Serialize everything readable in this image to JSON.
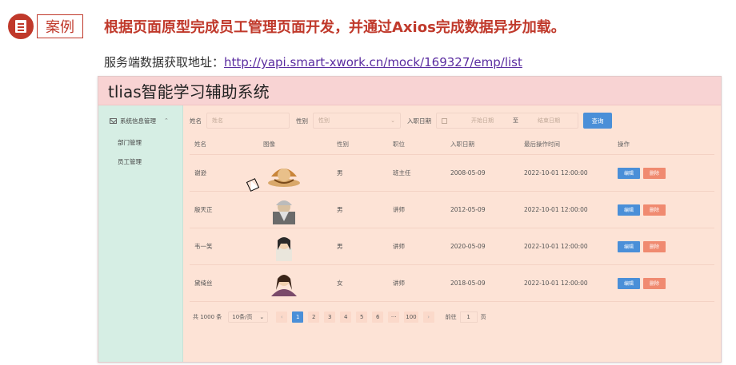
{
  "slide": {
    "case_label": "案例",
    "title": "根据页面原型完成员工管理页面开发，并通过Axios完成数据异步加载。",
    "source_prefix": "服务端数据获取地址：",
    "source_url": "http://yapi.smart-xwork.cn/mock/169327/emp/list"
  },
  "app": {
    "title": "tlias智能学习辅助系统",
    "sidebar": {
      "group_label": "系统信息管理",
      "group_icon": "mail-icon",
      "items": [
        {
          "label": "部门管理"
        },
        {
          "label": "员工管理"
        }
      ]
    },
    "search": {
      "name_label": "姓名",
      "name_placeholder": "姓名",
      "gender_label": "性别",
      "gender_placeholder": "性别",
      "date_label": "入职日期",
      "date_start_placeholder": "开始日期",
      "date_separator": "至",
      "date_end_placeholder": "结束日期",
      "query_button": "查询"
    },
    "table": {
      "headers": [
        "姓名",
        "图像",
        "性别",
        "职位",
        "入职日期",
        "最后操作时间",
        "操作"
      ],
      "edit_label": "编辑",
      "delete_label": "删除",
      "rows": [
        {
          "name": "谢逊",
          "gender": "男",
          "job": "班主任",
          "entry_date": "2008-05-09",
          "update_time": "2022-10-01 12:00:00"
        },
        {
          "name": "殷天正",
          "gender": "男",
          "job": "讲师",
          "entry_date": "2012-05-09",
          "update_time": "2022-10-01 12:00:00"
        },
        {
          "name": "韦一笑",
          "gender": "男",
          "job": "讲师",
          "entry_date": "2020-05-09",
          "update_time": "2022-10-01 12:00:00"
        },
        {
          "name": "黛绮丝",
          "gender": "女",
          "job": "讲师",
          "entry_date": "2018-05-09",
          "update_time": "2022-10-01 12:00:00"
        }
      ]
    },
    "pagination": {
      "total": "共 1000 条",
      "page_size": "10条/页",
      "pages": [
        "1",
        "2",
        "3",
        "4",
        "5",
        "6",
        "···",
        "100"
      ],
      "active_page": "1",
      "goto_label": "前往",
      "goto_value": "1",
      "page_unit": "页"
    }
  },
  "colors": {
    "accent_red": "#c0392b",
    "header_bg": "#f8d3d3",
    "sidebar_bg": "#d6eee4",
    "content_bg": "#fde3d6",
    "primary_blue": "#4a8fd8",
    "danger": "#f08a70"
  }
}
